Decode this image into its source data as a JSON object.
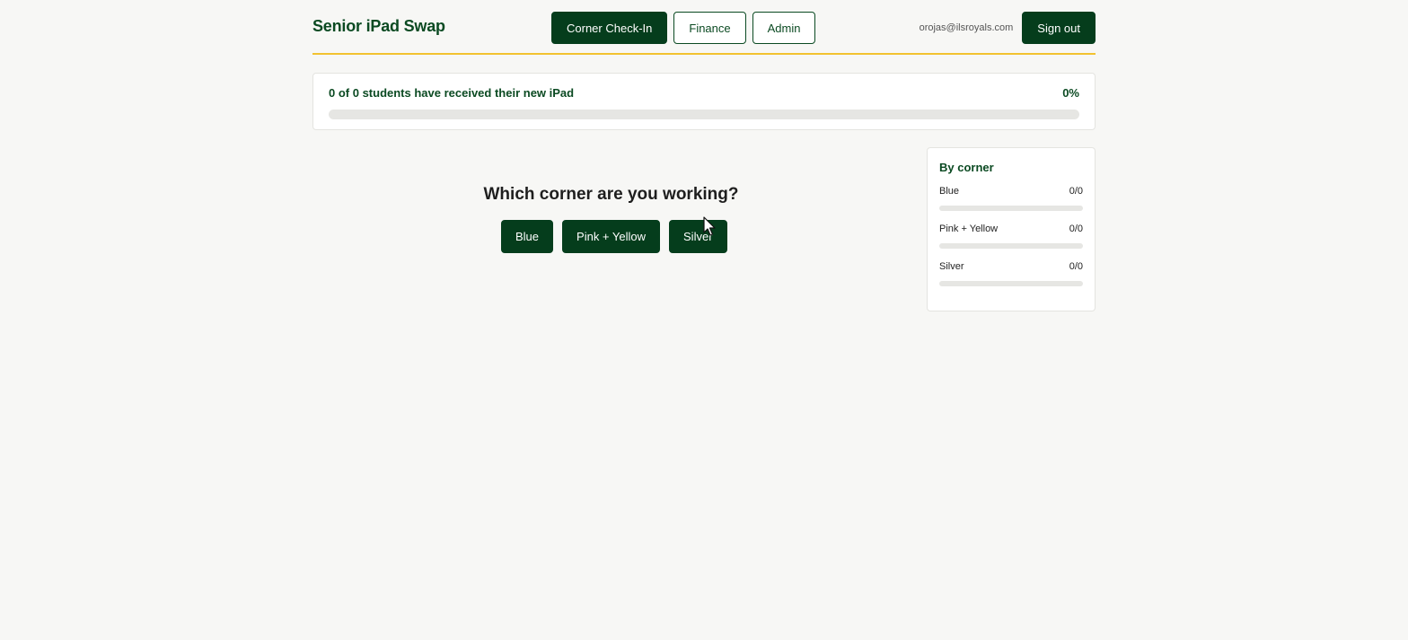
{
  "header": {
    "brand": "Senior iPad Swap",
    "nav": [
      {
        "label": "Corner Check-In",
        "active": true
      },
      {
        "label": "Finance",
        "active": false
      },
      {
        "label": "Admin",
        "active": false
      }
    ],
    "user_email": "orojas@ilsroyals.com",
    "signout_label": "Sign out"
  },
  "progress": {
    "summary": "0 of 0 students have received their new iPad",
    "percent_label": "0%",
    "fraction": 0
  },
  "corner_picker": {
    "question": "Which corner are you working?",
    "options": [
      "Blue",
      "Pink + Yellow",
      "Silver"
    ]
  },
  "by_corner": {
    "title": "By corner",
    "items": [
      {
        "name": "Blue",
        "count": "0/0",
        "fraction": 0
      },
      {
        "name": "Pink + Yellow",
        "count": "0/0",
        "fraction": 0
      },
      {
        "name": "Silver",
        "count": "0/0",
        "fraction": 0
      }
    ]
  },
  "colors": {
    "brand_green": "#0b4a22",
    "button_green": "#053d1c",
    "accent_yellow": "#f2c230",
    "background": "#f7f7f5"
  },
  "icons": {
    "cursor": "pointer-cursor-icon"
  }
}
